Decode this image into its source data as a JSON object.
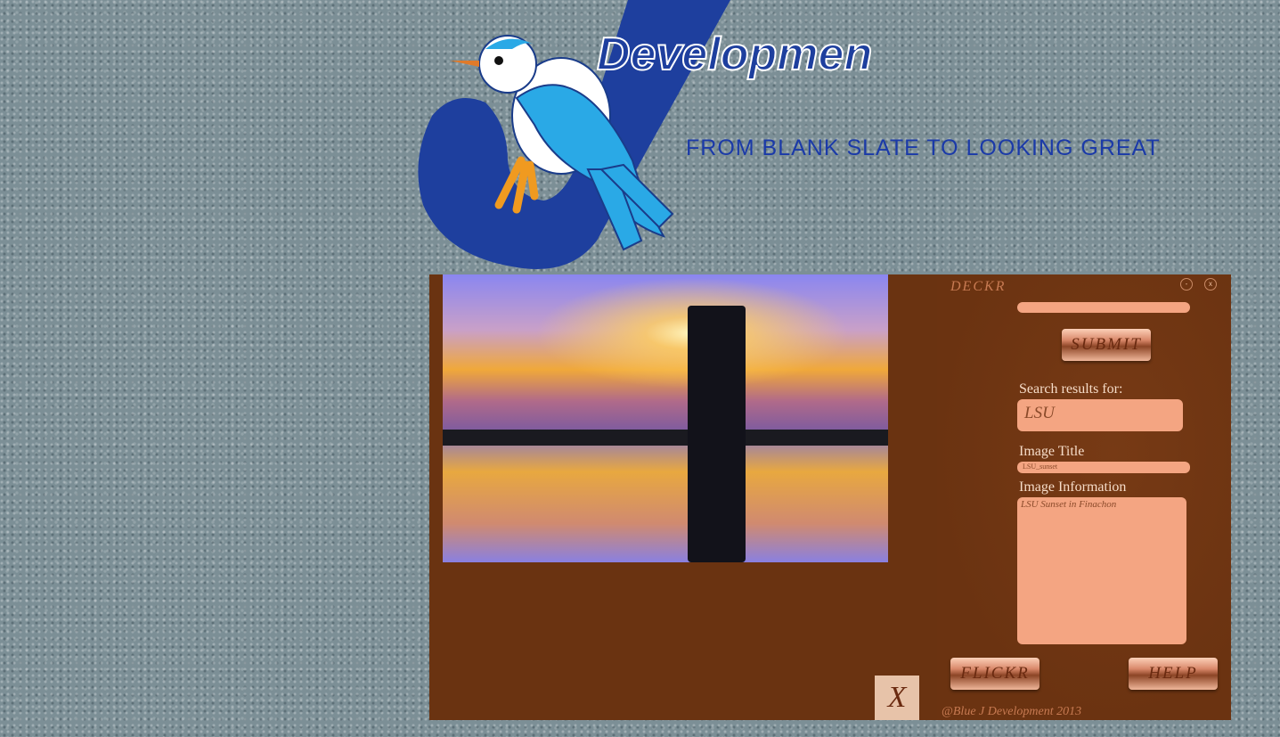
{
  "header": {
    "logo_word": "Development",
    "tagline": "FROM BLANK SLATE TO LOOKING GREAT"
  },
  "app": {
    "brand": "DECKR",
    "minimize_label": "-",
    "close_label": "x",
    "search": {
      "value": ""
    },
    "submit_label": "SUBMIT",
    "results_label": "Search results for:",
    "results_value": "LSU",
    "image_title_label": "Image Title",
    "image_title_value": "LSU_sunset",
    "image_info_label": "Image Information",
    "image_info_value": "LSU Sunset in Finachon",
    "flickr_label": "FLICKR",
    "help_label": "HELP",
    "close_x_label": "X",
    "footer": "@Blue J Development 2013"
  }
}
